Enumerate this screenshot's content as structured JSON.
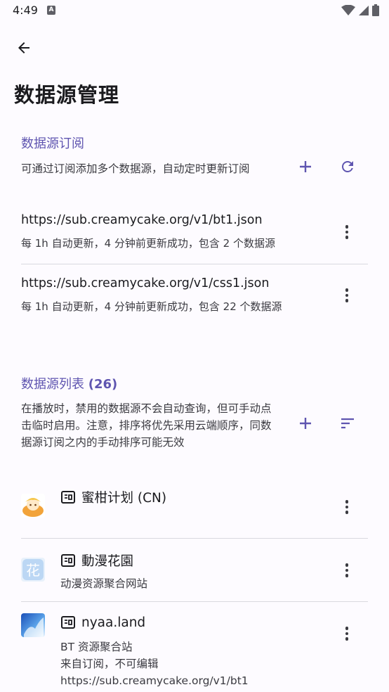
{
  "status_bar": {
    "time": "4:49",
    "notif_letter": "A"
  },
  "header": {
    "title": "数据源管理"
  },
  "subscriptions": {
    "title": "数据源订阅",
    "description": "可通过订阅添加多个数据源，自动定时更新订阅",
    "items": [
      {
        "url": "https://sub.creamycake.org/v1/bt1.json",
        "info": "每 1h 自动更新，4 分钟前更新成功，包含 2 个数据源"
      },
      {
        "url": "https://sub.creamycake.org/v1/css1.json",
        "info": "每 1h 自动更新，4 分钟前更新成功，包含 22 个数据源"
      }
    ]
  },
  "sources": {
    "title": "数据源列表",
    "count": "(26)",
    "description": "在播放时，禁用的数据源不会自动查询，但可手动点击临时启用。注意，排序将优先采用云端顺序，同数据源订阅之内的手动排序可能无效",
    "items": [
      {
        "name": "蜜柑计划 (CN)",
        "desc_lines": []
      },
      {
        "name": "動漫花園",
        "desc_lines": [
          "动漫资源聚合网站"
        ]
      },
      {
        "name": "nyaa.land",
        "desc_lines": [
          "BT 资源聚合站",
          "来自订阅，不可编辑",
          "https://sub.creamycake.org/v1/bt1"
        ]
      }
    ]
  },
  "colors": {
    "accent": "#5f55b0",
    "background": "#fdfbff"
  }
}
